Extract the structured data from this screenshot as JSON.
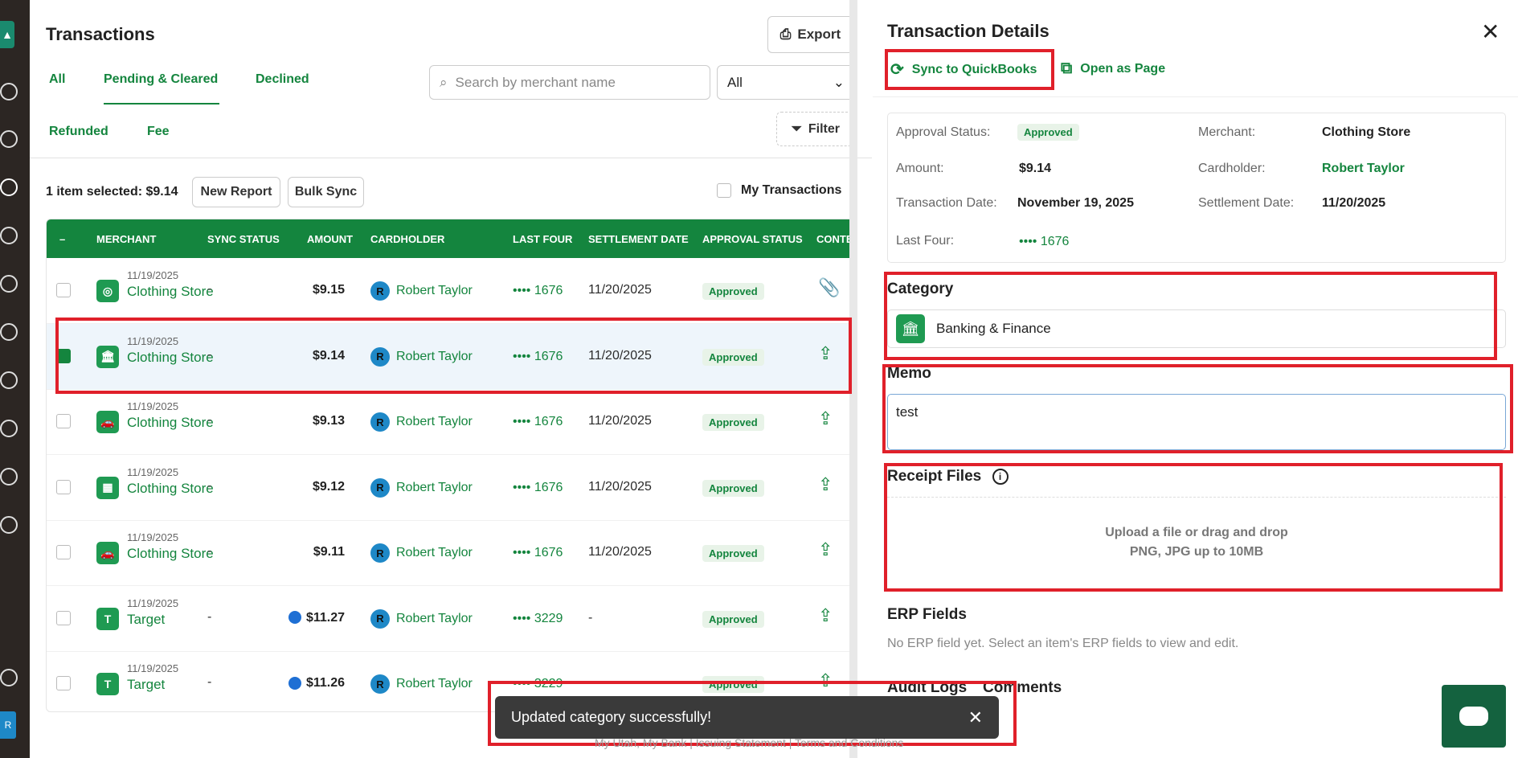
{
  "sidebar": {
    "avatar_letter": "R"
  },
  "list": {
    "title": "Transactions",
    "export_label": "Export",
    "tabs": [
      "All",
      "Pending & Cleared",
      "Declined",
      "Refunded",
      "Fee"
    ],
    "active_tab": "Pending & Cleared",
    "search_placeholder": "Search by merchant name",
    "select_value": "All",
    "filter_label": "Filter",
    "selection_info": "1 item selected: $9.14",
    "new_report_label": "New Report",
    "bulk_sync_label": "Bulk Sync",
    "my_transactions_label": "My Transactions",
    "columns": [
      "MERCHANT",
      "SYNC STATUS",
      "AMOUNT",
      "CARDHOLDER",
      "LAST FOUR",
      "SETTLEMENT DATE",
      "APPROVAL STATUS",
      "CONTE"
    ],
    "header_check": "–",
    "rows": [
      {
        "date": "11/19/2025",
        "merchant": "Clothing Store",
        "sync": "-",
        "amount": "$9.15",
        "cardholder": "Robert Taylor",
        "avatar": "R",
        "last_four": "•••• 1676",
        "settlement": "11/20/2025",
        "status": "Approved",
        "icon_letter": "◎",
        "content_icon": "paperclip-icon",
        "content_glyph": "📎",
        "checked": false,
        "pending": false
      },
      {
        "date": "11/19/2025",
        "merchant": "Clothing Store",
        "sync": "-",
        "amount": "$9.14",
        "cardholder": "Robert Taylor",
        "avatar": "R",
        "last_four": "•••• 1676",
        "settlement": "11/20/2025",
        "status": "Approved",
        "icon_letter": "🏛",
        "content_icon": "upload-icon",
        "content_glyph": "⇪",
        "checked": true,
        "pending": false
      },
      {
        "date": "11/19/2025",
        "merchant": "Clothing Store",
        "sync": "-",
        "amount": "$9.13",
        "cardholder": "Robert Taylor",
        "avatar": "R",
        "last_four": "•••• 1676",
        "settlement": "11/20/2025",
        "status": "Approved",
        "icon_letter": "🚗",
        "content_icon": "upload-icon",
        "content_glyph": "⇪",
        "checked": false,
        "pending": false
      },
      {
        "date": "11/19/2025",
        "merchant": "Clothing Store",
        "sync": "-",
        "amount": "$9.12",
        "cardholder": "Robert Taylor",
        "avatar": "R",
        "last_four": "•••• 1676",
        "settlement": "11/20/2025",
        "status": "Approved",
        "icon_letter": "▦",
        "content_icon": "upload-icon",
        "content_glyph": "⇪",
        "checked": false,
        "pending": false
      },
      {
        "date": "11/19/2025",
        "merchant": "Clothing Store",
        "sync": "-",
        "amount": "$9.11",
        "cardholder": "Robert Taylor",
        "avatar": "R",
        "last_four": "•••• 1676",
        "settlement": "11/20/2025",
        "status": "Approved",
        "icon_letter": "🚗",
        "content_icon": "upload-icon",
        "content_glyph": "⇪",
        "checked": false,
        "pending": false
      },
      {
        "date": "11/19/2025",
        "merchant": "Target",
        "sync": "-",
        "amount": "$11.27",
        "cardholder": "Robert Taylor",
        "avatar": "R",
        "last_four": "•••• 3229",
        "settlement": "-",
        "status": "Approved",
        "icon_letter": "T",
        "content_icon": "upload-icon",
        "content_glyph": "⇪",
        "checked": false,
        "pending": true
      },
      {
        "date": "11/19/2025",
        "merchant": "Target",
        "sync": "-",
        "amount": "$11.26",
        "cardholder": "Robert Taylor",
        "avatar": "R",
        "last_four": "•••• 3229",
        "settlement": "-",
        "status": "Approved",
        "icon_letter": "T",
        "content_icon": "upload-icon",
        "content_glyph": "⇪",
        "checked": false,
        "pending": true
      }
    ]
  },
  "details": {
    "title": "Transaction Details",
    "sync_label": "Sync to QuickBooks",
    "open_page_label": "Open as Page",
    "approval_status_label": "Approval Status:",
    "approval_status": "Approved",
    "merchant_label": "Merchant:",
    "merchant": "Clothing Store",
    "amount_label": "Amount:",
    "amount": "$9.14",
    "cardholder_label": "Cardholder:",
    "cardholder": "Robert Taylor",
    "transaction_date_label": "Transaction Date:",
    "transaction_date": "November 19, 2025",
    "settlement_date_label": "Settlement Date:",
    "settlement_date": "11/20/2025",
    "last_four_label": "Last Four:",
    "last_four": "•••• 1676",
    "category_heading": "Category",
    "category": "Banking & Finance",
    "memo_heading": "Memo",
    "memo": "test",
    "receipt_heading": "Receipt Files",
    "upload_line1": "Upload a file or drag and drop",
    "upload_line2": "PNG, JPG up to 10MB",
    "erp_heading": "ERP Fields",
    "erp_text": "No ERP field yet. Select an item's ERP fields to view and edit.",
    "audit_logs_tab": "Audit Logs",
    "comments_tab": "Comments"
  },
  "toast": {
    "message": "Updated category successfully!"
  },
  "footer": {
    "text": "My Utah, My Bank | Issuing Statement | Terms and Conditions"
  },
  "colors": {
    "brand_green": "#14853e",
    "highlight_red": "#e0202a",
    "sidebar": "#2c2623"
  }
}
